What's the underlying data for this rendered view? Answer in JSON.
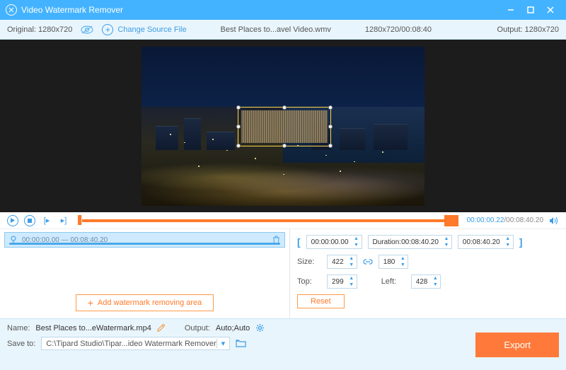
{
  "app": {
    "title": "Video Watermark Remover"
  },
  "toolbar": {
    "original_label": "Original:",
    "original_dim": "1280x720",
    "change_source": "Change Source File",
    "filename": "Best Places to...avel Video.wmv",
    "file_dim_dur": "1280x720/00:08:40",
    "output_label": "Output:",
    "output_dim": "1280x720"
  },
  "playback": {
    "current": "00:00:00.22",
    "total": "00:08:40.20"
  },
  "segment": {
    "start": "00:00:00.00",
    "sep": "—",
    "end": "00:08:40.20"
  },
  "add_area_label": "Add watermark removing area",
  "range": {
    "start": "00:00:00.00",
    "duration_label": "Duration:",
    "duration": "00:08:40.20",
    "end": "00:08:40.20"
  },
  "size": {
    "label": "Size:",
    "w": "422",
    "h": "180"
  },
  "pos": {
    "top_label": "Top:",
    "top": "299",
    "left_label": "Left:",
    "left": "428"
  },
  "reset_label": "Reset",
  "bottom": {
    "name_label": "Name:",
    "name_value": "Best Places to...eWatermark.mp4",
    "output_label": "Output:",
    "output_value": "Auto;Auto",
    "save_label": "Save to:",
    "save_path": "C:\\Tipard Studio\\Tipar...ideo Watermark Remover",
    "export": "Export"
  }
}
